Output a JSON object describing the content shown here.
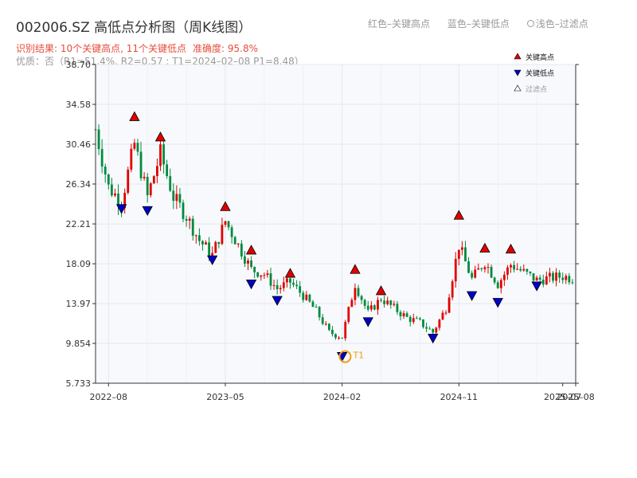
{
  "title": "002006.SZ 高低点分析图（周K线图）",
  "legend_top": {
    "red": "红色–关键高点",
    "blue": "蓝色–关键低点",
    "light": "浅色–过滤点"
  },
  "subtitle": {
    "result": "识别结果: 10个关键高点, 11个关键低点",
    "accuracy": "准确度: 95.8%"
  },
  "quality_line": "优质：否（R1=51.4%, R2=0.57 ; T1=2024–02–08 P1=8.48）",
  "chart_data": {
    "type": "candlestick",
    "title": "002006.SZ 高低点分析图（周K线图）",
    "y_ticks": [
      "5.733",
      "9.854",
      "13.97",
      "18.09",
      "22.21",
      "26.34",
      "30.46",
      "34.58",
      "38.70"
    ],
    "ylim": [
      5.733,
      38.7
    ],
    "x_ticks": [
      "2022–08",
      "2023–05",
      "2024–02",
      "2024–11",
      "2025–07",
      "2025–08"
    ],
    "xlim": [
      "2022-07",
      "2025-08"
    ],
    "grid": true,
    "colors": {
      "up": "#e00000",
      "down": "#008a3e",
      "high_marker": "#e00000",
      "low_marker": "#0000cc",
      "t1": "#f39c12"
    },
    "legend": {
      "position": "top-right",
      "items": [
        {
          "label": "关键高点",
          "marker": "up-triangle",
          "color": "#e00000"
        },
        {
          "label": "关键低点",
          "marker": "down-triangle",
          "color": "#0000cc"
        },
        {
          "label": "过滤点",
          "marker": "up-triangle-light",
          "color": "#ffffff"
        }
      ]
    },
    "key_highs": [
      {
        "date": "2022-10",
        "price": 33.3
      },
      {
        "date": "2022-12",
        "price": 31.2
      },
      {
        "date": "2023-05",
        "price": 24.0
      },
      {
        "date": "2023-07",
        "price": 19.5
      },
      {
        "date": "2023-10",
        "price": 17.1
      },
      {
        "date": "2024-03",
        "price": 17.5
      },
      {
        "date": "2024-05",
        "price": 15.3
      },
      {
        "date": "2024-11",
        "price": 23.1
      },
      {
        "date": "2025-01",
        "price": 19.7
      },
      {
        "date": "2025-03",
        "price": 19.6
      }
    ],
    "key_lows": [
      {
        "date": "2022-09",
        "price": 23.8
      },
      {
        "date": "2022-11",
        "price": 23.6
      },
      {
        "date": "2023-04",
        "price": 18.5
      },
      {
        "date": "2023-07",
        "price": 16.0
      },
      {
        "date": "2023-09",
        "price": 14.3
      },
      {
        "date": "2024-02",
        "price": 8.5
      },
      {
        "date": "2024-04",
        "price": 12.1
      },
      {
        "date": "2024-09",
        "price": 10.4
      },
      {
        "date": "2024-12",
        "price": 14.8
      },
      {
        "date": "2025-02",
        "price": 14.1
      },
      {
        "date": "2025-05",
        "price": 15.8
      }
    ],
    "t1_marker": {
      "label": "T1",
      "date": "2024-02-08",
      "price": 8.48
    },
    "close_path": [
      {
        "date": "2022-07",
        "price": 32.0
      },
      {
        "date": "2022-08",
        "price": 26.0
      },
      {
        "date": "2022-09",
        "price": 24.5
      },
      {
        "date": "2022-10",
        "price": 30.5
      },
      {
        "date": "2022-11",
        "price": 25.0
      },
      {
        "date": "2022-12",
        "price": 29.5
      },
      {
        "date": "2023-01",
        "price": 25.0
      },
      {
        "date": "2023-02",
        "price": 23.0
      },
      {
        "date": "2023-03",
        "price": 20.5
      },
      {
        "date": "2023-04",
        "price": 19.0
      },
      {
        "date": "2023-05",
        "price": 22.5
      },
      {
        "date": "2023-06",
        "price": 20.0
      },
      {
        "date": "2023-07",
        "price": 17.5
      },
      {
        "date": "2023-08",
        "price": 17.0
      },
      {
        "date": "2023-09",
        "price": 15.5
      },
      {
        "date": "2023-10",
        "price": 16.2
      },
      {
        "date": "2023-11",
        "price": 14.8
      },
      {
        "date": "2023-12",
        "price": 13.2
      },
      {
        "date": "2024-01",
        "price": 11.0
      },
      {
        "date": "2024-02",
        "price": 10.5
      },
      {
        "date": "2024-03",
        "price": 16.0
      },
      {
        "date": "2024-04",
        "price": 13.0
      },
      {
        "date": "2024-05",
        "price": 14.5
      },
      {
        "date": "2024-06",
        "price": 13.5
      },
      {
        "date": "2024-07",
        "price": 12.5
      },
      {
        "date": "2024-08",
        "price": 12.0
      },
      {
        "date": "2024-09",
        "price": 11.0
      },
      {
        "date": "2024-10",
        "price": 13.5
      },
      {
        "date": "2024-11",
        "price": 20.0
      },
      {
        "date": "2024-12",
        "price": 16.5
      },
      {
        "date": "2025-01",
        "price": 18.3
      },
      {
        "date": "2025-02",
        "price": 16.0
      },
      {
        "date": "2025-03",
        "price": 18.0
      },
      {
        "date": "2025-04",
        "price": 17.2
      },
      {
        "date": "2025-05",
        "price": 16.4
      },
      {
        "date": "2025-06",
        "price": 16.6
      },
      {
        "date": "2025-07",
        "price": 16.8
      },
      {
        "date": "2025-08",
        "price": 16.5
      }
    ]
  }
}
